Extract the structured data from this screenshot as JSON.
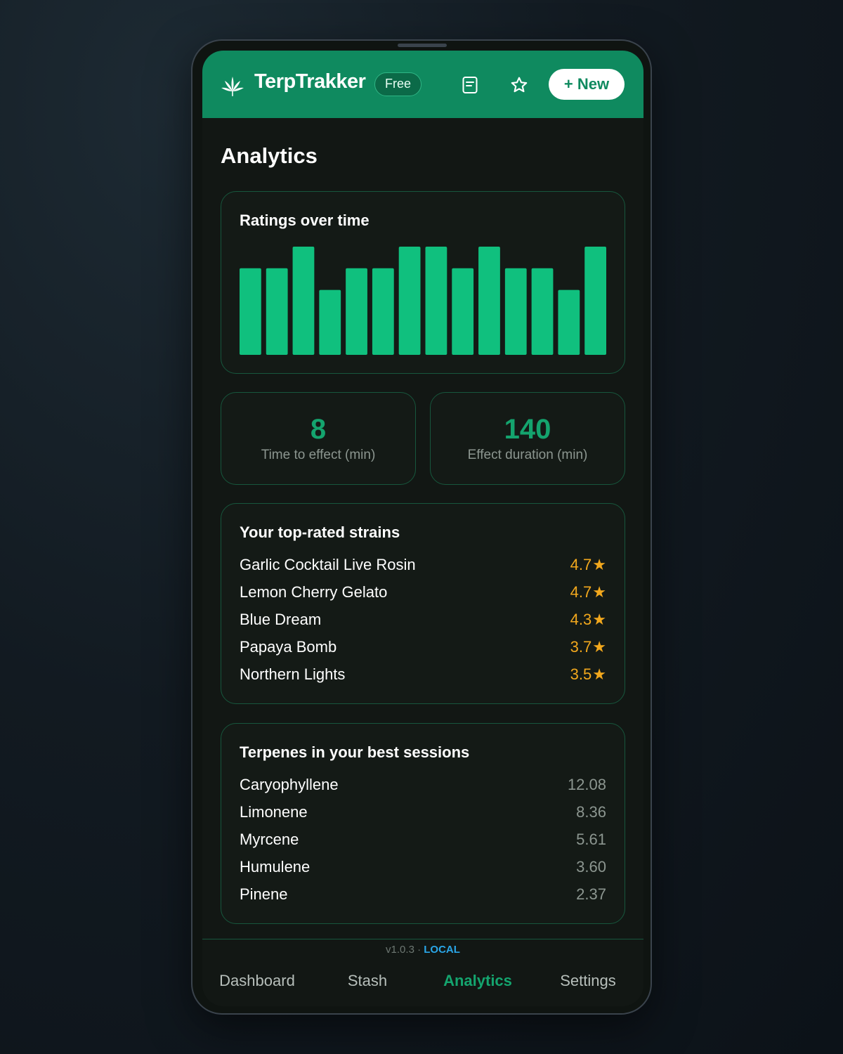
{
  "header": {
    "app_title": "TerpTrakker",
    "plan_badge": "Free",
    "new_button": "+ New",
    "accent_color": "#0f8a5f",
    "icons": [
      "cannabis-leaf-icon",
      "notes-icon",
      "star-icon"
    ]
  },
  "page": {
    "title": "Analytics"
  },
  "ratings_chart": {
    "title": "Ratings over time"
  },
  "chart_data": {
    "type": "bar",
    "values": [
      4,
      4,
      5,
      3,
      4,
      4,
      5,
      5,
      4,
      5,
      4,
      4,
      3,
      5
    ],
    "ylim": [
      0,
      5
    ],
    "color": "#10c07e"
  },
  "stats": {
    "time_to_effect": {
      "value": "8",
      "label": "Time to effect (min)"
    },
    "effect_duration": {
      "value": "140",
      "label": "Effect duration (min)"
    }
  },
  "top_strains": {
    "title": "Your top-rated strains",
    "items": [
      {
        "name": "Garlic Cocktail Live Rosin",
        "rating": "4.7"
      },
      {
        "name": "Lemon Cherry Gelato",
        "rating": "4.7"
      },
      {
        "name": "Blue Dream",
        "rating": "4.3"
      },
      {
        "name": "Papaya Bomb",
        "rating": "3.7"
      },
      {
        "name": "Northern Lights",
        "rating": "3.5"
      }
    ],
    "rating_color": "#f2a81d"
  },
  "terpenes": {
    "title": "Terpenes in your best sessions",
    "items": [
      {
        "name": "Caryophyllene",
        "value": "12.08"
      },
      {
        "name": "Limonene",
        "value": "8.36"
      },
      {
        "name": "Myrcene",
        "value": "5.61"
      },
      {
        "name": "Humulene",
        "value": "3.60"
      },
      {
        "name": "Pinene",
        "value": "2.37"
      }
    ]
  },
  "footer": {
    "version": "v1.0.3",
    "separator": " · ",
    "environment": "LOCAL",
    "tabs": [
      {
        "label": "Dashboard"
      },
      {
        "label": "Stash"
      },
      {
        "label": "Analytics",
        "active": true
      },
      {
        "label": "Settings"
      }
    ]
  }
}
